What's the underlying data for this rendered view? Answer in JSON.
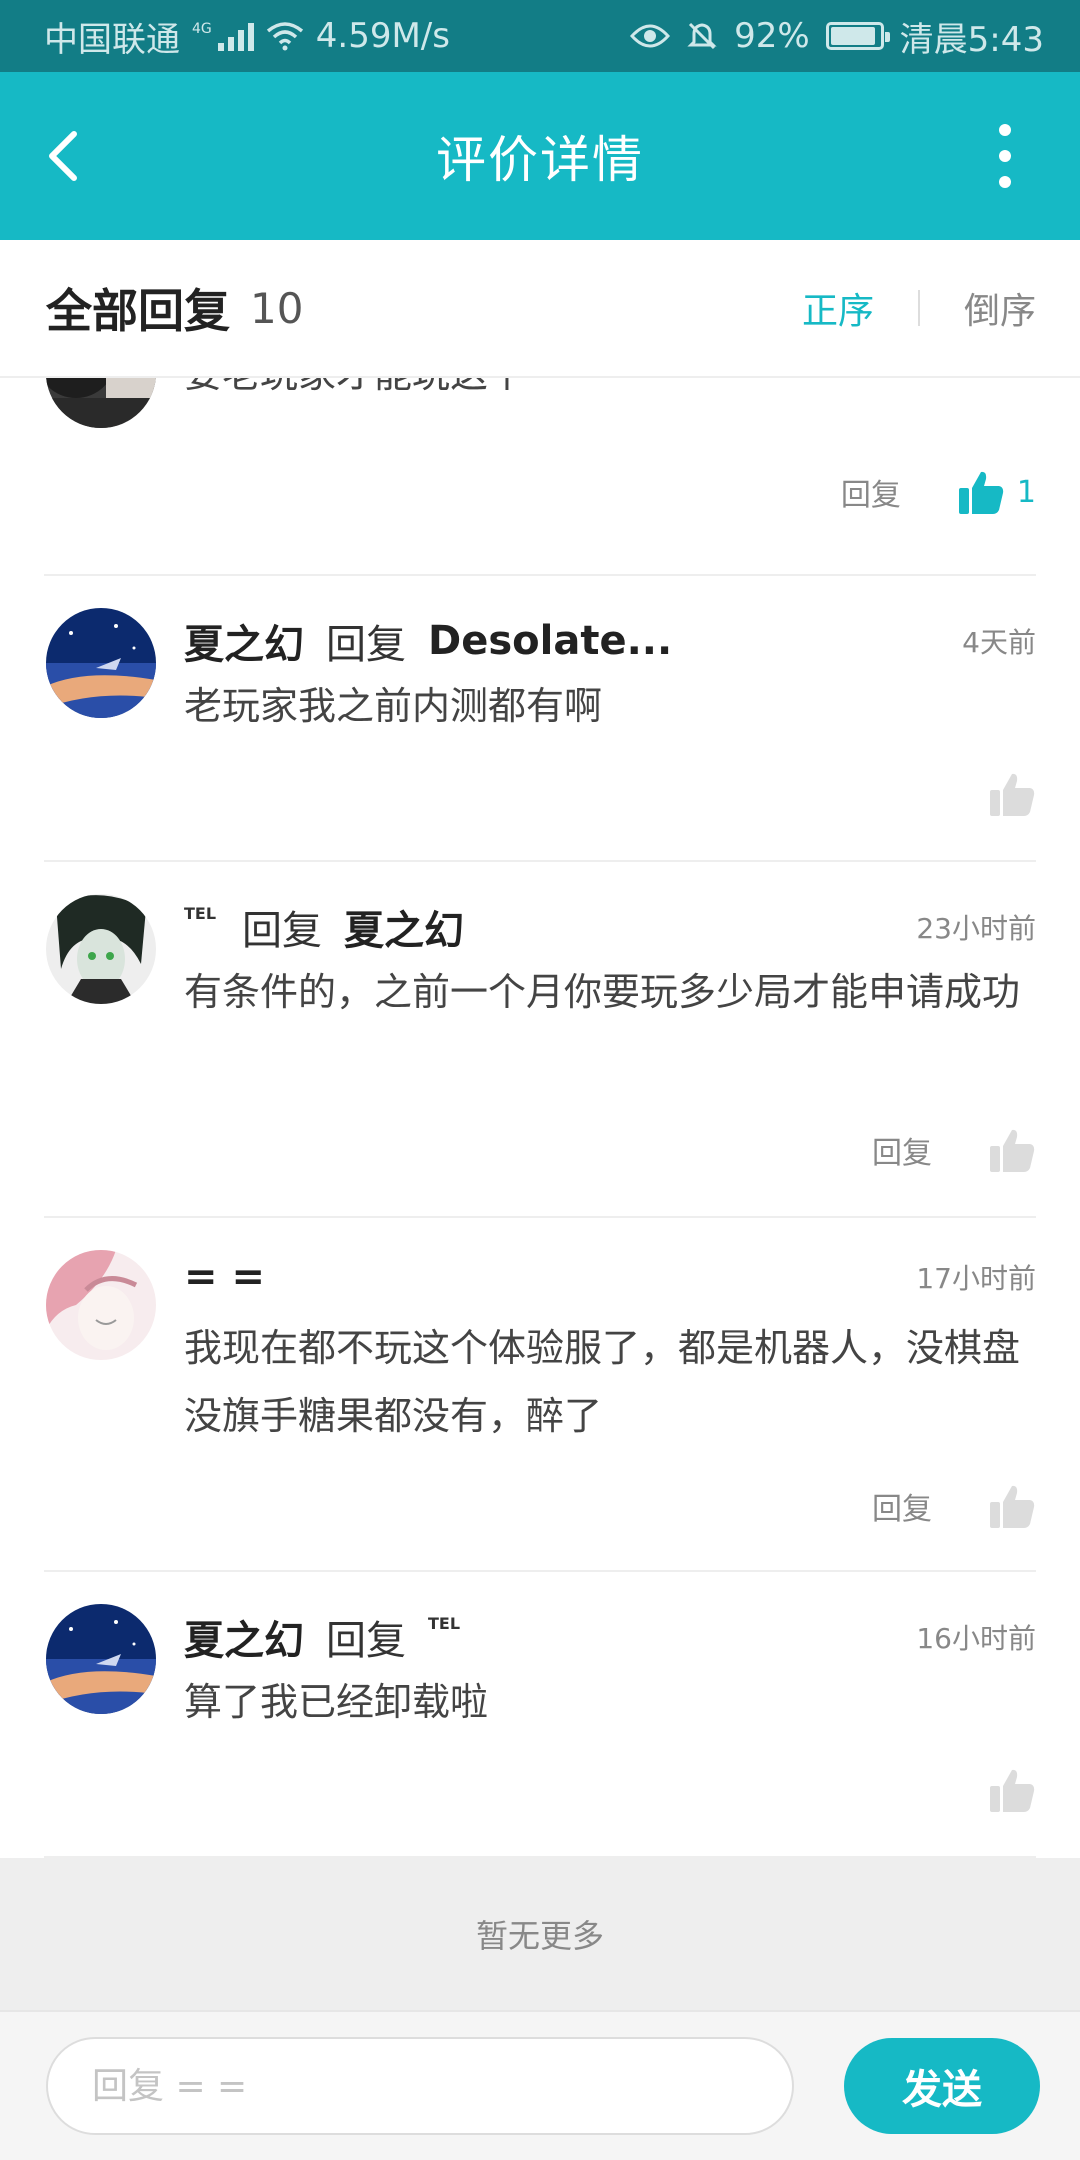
{
  "status_bar": {
    "carrier": "中国联通",
    "network_tag": "4G",
    "speed": "4.59M/s",
    "battery": "92%",
    "battery_level": 0.92,
    "time": "清晨5:43",
    "icons": [
      "signal-icon",
      "wifi-icon",
      "eye-icon",
      "bell-off-icon",
      "battery-icon"
    ]
  },
  "app_bar": {
    "title": "评价详情",
    "back_icon": "back-arrow-icon",
    "more_icon": "more-vertical-icon"
  },
  "section": {
    "label": "全部回复",
    "count": "10",
    "sort_asc": "正序",
    "sort_desc": "倒序",
    "active_sort": "正序"
  },
  "comments": [
    {
      "text": "要老玩家才能玩这个",
      "reply_label": "回复",
      "likes": "1",
      "liked": true
    },
    {
      "name": "夏之幻",
      "reply_word": "回复",
      "target": "Desolate...",
      "time": "4天前",
      "text": "老玩家我之前内测都有啊",
      "liked": false
    },
    {
      "name": "TEL",
      "reply_word": "回复",
      "target": "夏之幻",
      "time": "23小时前",
      "text": "有条件的，之前一个月你要玩多少局才能申请成功",
      "reply_label": "回复",
      "liked": false
    },
    {
      "name": "= =",
      "time": "17小时前",
      "text": "我现在都不玩这个体验服了，都是机器人，没棋盘没旗手糖果都没有，醉了",
      "reply_label": "回复",
      "liked": false
    },
    {
      "name": "夏之幻",
      "reply_word": "回复",
      "target": "TEL",
      "time": "16小时前",
      "text": "算了我已经卸载啦",
      "liked": false
    }
  ],
  "no_more": "暂无更多",
  "input": {
    "placeholder": "回复 = =",
    "value": ""
  },
  "send_label": "发送",
  "colors": {
    "accent": "#16b9c5",
    "status_bar": "#127d86",
    "thumb_inactive": "#dcdcdc"
  }
}
